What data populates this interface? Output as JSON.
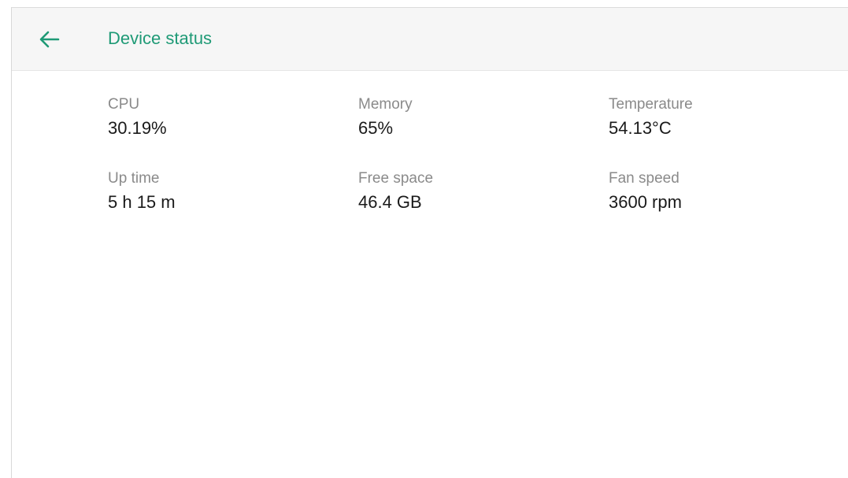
{
  "header": {
    "title": "Device status",
    "back_icon": "arrow-left-icon",
    "accent_color": "#1f9a76"
  },
  "stats": [
    {
      "label": "CPU",
      "value": "30.19%"
    },
    {
      "label": "Memory",
      "value": "65%"
    },
    {
      "label": "Temperature",
      "value": "54.13°C"
    },
    {
      "label": "Up time",
      "value": "5 h 15 m"
    },
    {
      "label": "Free space",
      "value": "46.4 GB"
    },
    {
      "label": "Fan speed",
      "value": "3600 rpm"
    }
  ]
}
